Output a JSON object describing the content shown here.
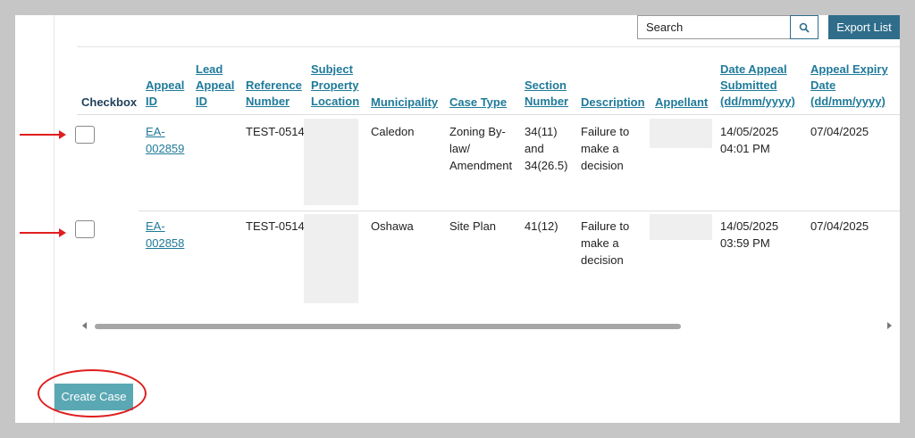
{
  "toolbar": {
    "search_value": "Search",
    "export_label": "Export List"
  },
  "columns": [
    {
      "key": "checkbox",
      "lines": [
        "Checkbox"
      ],
      "sortable": false
    },
    {
      "key": "appeal_id",
      "lines": [
        "Appeal",
        "ID"
      ],
      "sortable": true
    },
    {
      "key": "lead_appeal_id",
      "lines": [
        "Lead",
        "Appeal",
        "ID"
      ],
      "sortable": true
    },
    {
      "key": "reference_number",
      "lines": [
        "Reference",
        "Number"
      ],
      "sortable": true
    },
    {
      "key": "subject_property_location",
      "lines": [
        "Subject",
        "Property",
        "Location"
      ],
      "sortable": true
    },
    {
      "key": "municipality",
      "lines": [
        "Municipality"
      ],
      "sortable": true
    },
    {
      "key": "case_type",
      "lines": [
        "Case Type"
      ],
      "sortable": true
    },
    {
      "key": "section_number",
      "lines": [
        "Section",
        "Number"
      ],
      "sortable": true
    },
    {
      "key": "description",
      "lines": [
        "Description"
      ],
      "sortable": true
    },
    {
      "key": "appellant",
      "lines": [
        "Appellant"
      ],
      "sortable": true
    },
    {
      "key": "date_appeal_submitted",
      "lines": [
        "Date Appeal",
        "Submitted",
        "(dd/mm/yyyy)"
      ],
      "sortable": true
    },
    {
      "key": "appeal_expiry_date",
      "lines": [
        "Appeal Expiry",
        "Date",
        "(dd/mm/yyyy)"
      ],
      "sortable": true
    }
  ],
  "rows": [
    {
      "appeal_id": [
        "EA-",
        "002859"
      ],
      "lead_appeal_id": "",
      "reference_number": "TEST-0514",
      "municipality": "Caledon",
      "case_type": [
        "Zoning By-",
        "law/",
        "Amendment"
      ],
      "section_number": [
        "34(11)",
        "and",
        "34(26.5)"
      ],
      "description": [
        "Failure to",
        "make a",
        "decision"
      ],
      "date_appeal_submitted": [
        "14/05/2025",
        "04:01 PM"
      ],
      "appeal_expiry_date": "07/04/2025"
    },
    {
      "appeal_id": [
        "EA-",
        "002858"
      ],
      "lead_appeal_id": "",
      "reference_number": "TEST-0514",
      "municipality": "Oshawa",
      "case_type": [
        "Site Plan"
      ],
      "section_number": [
        "41(12)"
      ],
      "description": [
        "Failure to",
        "make a",
        "decision"
      ],
      "date_appeal_submitted": [
        "14/05/2025",
        "03:59 PM"
      ],
      "appeal_expiry_date": "07/04/2025"
    }
  ],
  "footer": {
    "create_case_label": "Create Case"
  },
  "colors": {
    "accent": "#2f6d8a",
    "link": "#1f7a99",
    "create_button": "#5aa8b4",
    "annotation_red": "#e01e1e"
  },
  "icons": {
    "search": "search-icon",
    "scroll_left": "scroll-left-arrow-icon",
    "scroll_right": "scroll-right-arrow-icon"
  }
}
